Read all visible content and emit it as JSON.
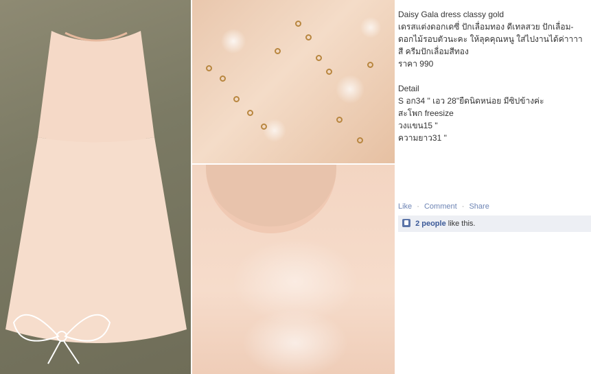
{
  "post": {
    "title": "Daisy Gala dress classy gold",
    "description_lines": [
      "เดรสแต่งดอกเดซี่ ปักเลื่อมทอง ดีเทลสวย ปักเลื่อม-",
      "ดอกไม้รอบตัวนะคะ ให้ลุคคุณหนู ใส่ไปงานได้ค่าาาา",
      "สี ครีมปักเลื่อมสีทอง",
      "ราคา 990"
    ],
    "detail_heading": "Detail",
    "detail_lines": [
      "S อก34 \" เอว 28\"ยืดนิดหน่อย มีซิปข้างค่ะ",
      "สะโพก freesize",
      "วงแขน15 \"",
      "ความยาว31 \""
    ]
  },
  "actions": {
    "like": "Like",
    "comment": "Comment",
    "share": "Share",
    "separator": "·"
  },
  "likes": {
    "icon": "thumbs-up-icon",
    "count_text": "2 people",
    "suffix": "like this."
  },
  "photos": {
    "main": "dress-full-photo",
    "detail": "sequin-detail-photo",
    "closeup": "bodice-closeup-photo"
  },
  "colors": {
    "link": "#6d84b4",
    "likes_bg": "#edeff4",
    "name_blue": "#3b5998"
  }
}
